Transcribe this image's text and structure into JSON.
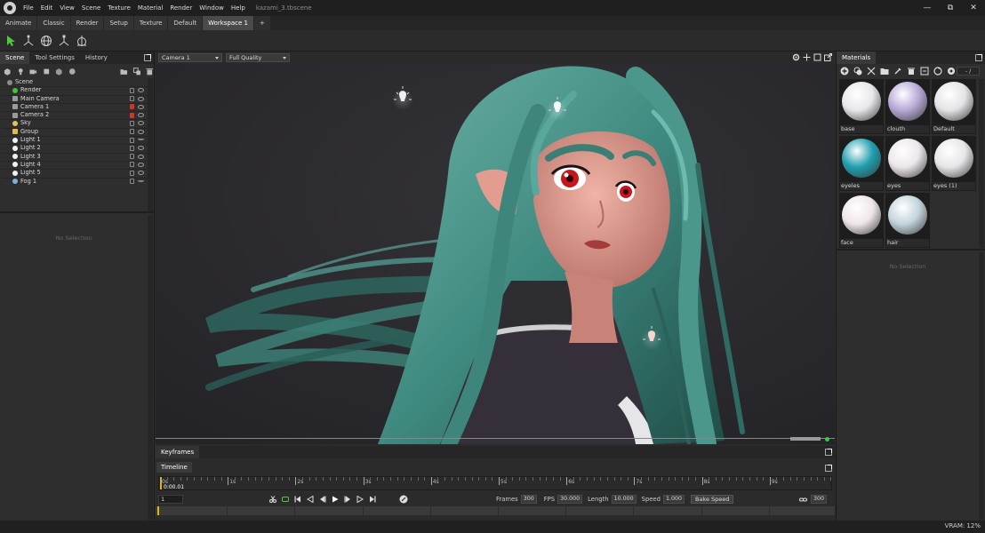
{
  "app": {
    "title": "kazami_3.tbscene",
    "menus": [
      "File",
      "Edit",
      "View",
      "Scene",
      "Texture",
      "Material",
      "Render",
      "Window",
      "Help"
    ],
    "window_controls": [
      "—",
      "⧉",
      "✕"
    ]
  },
  "workspace_tabs": [
    "Animate",
    "Classic",
    "Render",
    "Setup",
    "Texture",
    "Default",
    "Workspace 1",
    "+"
  ],
  "left_panel": {
    "tabs": [
      "Scene",
      "Tool Settings",
      "History"
    ],
    "tree": [
      {
        "label": "Scene",
        "icon": "scene-icon"
      },
      {
        "label": "Render",
        "icon": "render-icon"
      },
      {
        "label": "Main Camera",
        "icon": "camera-icon"
      },
      {
        "label": "Camera 1",
        "icon": "camera-icon"
      },
      {
        "label": "Camera 2",
        "icon": "camera-icon"
      },
      {
        "label": "Sky",
        "icon": "sky-icon"
      },
      {
        "label": "Group",
        "icon": "folder-icon"
      },
      {
        "label": "Light 1",
        "icon": "light-icon"
      },
      {
        "label": "Light 2",
        "icon": "light-icon"
      },
      {
        "label": "Light 3",
        "icon": "light-icon"
      },
      {
        "label": "Light 4",
        "icon": "light-icon"
      },
      {
        "label": "Light 5",
        "icon": "light-icon"
      },
      {
        "label": "Fog 1",
        "icon": "fog-icon"
      }
    ],
    "no_selection": "No Selection"
  },
  "viewport": {
    "camera": "Camera 1",
    "quality": "Full Quality"
  },
  "materials": {
    "tab": "Materials",
    "filter": "- /",
    "items": [
      {
        "name": "base",
        "color": "#e8e6ea"
      },
      {
        "name": "clouth",
        "color": "#b7a9d6"
      },
      {
        "name": "Default",
        "color": "#e4e4e6"
      },
      {
        "name": "eyeles",
        "color": "#1f9fae"
      },
      {
        "name": "eyes",
        "color": "#ece6ea"
      },
      {
        "name": "eyes (1)",
        "color": "#e6e6e8"
      },
      {
        "name": "face",
        "color": "#efe6ea"
      },
      {
        "name": "hair",
        "color": "#c3d4dc"
      }
    ],
    "no_selection": "No Selection"
  },
  "bottom": {
    "keyframes_tab": "Keyframes",
    "timeline_tab": "Timeline",
    "current_time": "0:00.01",
    "ruler_labels": [
      "0s",
      "1s",
      "2s",
      "3s",
      "4s",
      "5s",
      "6s",
      "7s",
      "8s",
      "9s"
    ],
    "frame": "1",
    "frames_label": "Frames",
    "frames": "300",
    "fps_label": "FPS",
    "fps": "30.000",
    "length_label": "Length",
    "length": "10.000",
    "speed_label": "Speed",
    "speed": "1.000",
    "bake_speed": "Bake Speed",
    "end_frame": "300"
  },
  "status": {
    "vram": "VRAM: 12%"
  },
  "colors": {
    "accent_yellow": "#e8b400",
    "hair": "#3f8a80",
    "lock_red": "#d0342c",
    "live_green": "#3ec93e"
  }
}
